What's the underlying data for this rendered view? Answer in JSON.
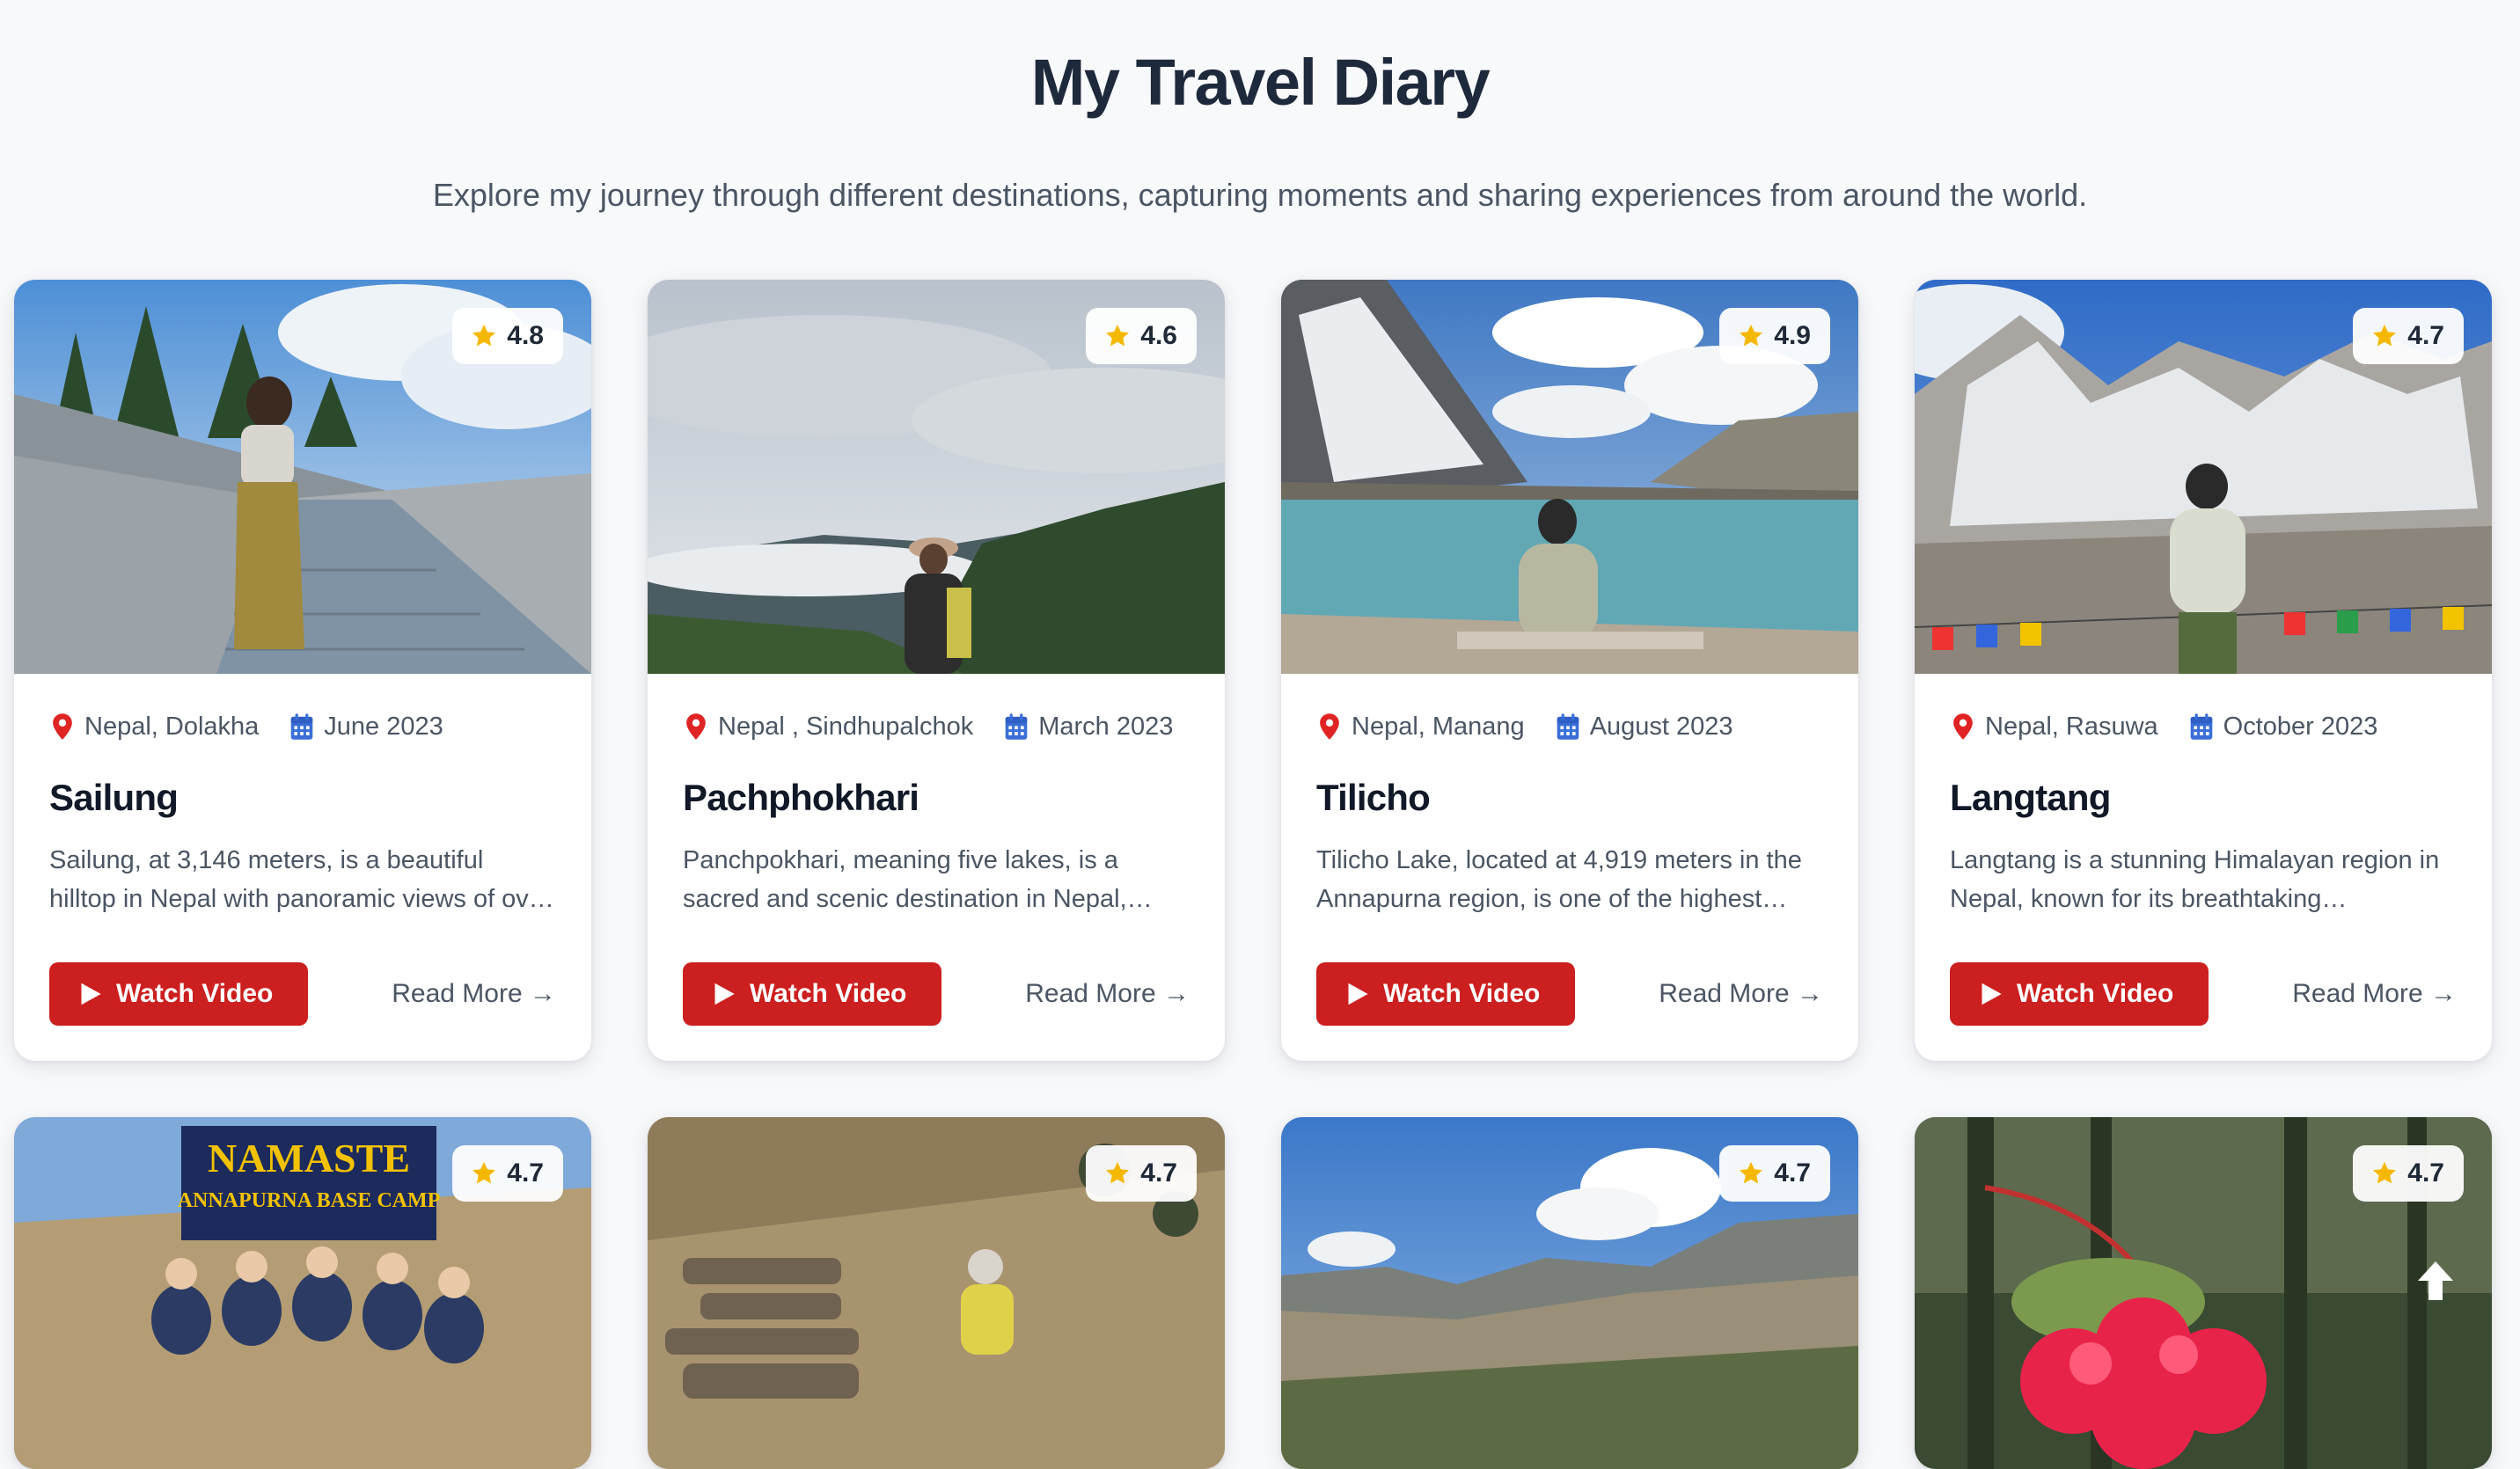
{
  "header": {
    "title": "My Travel Diary",
    "subtitle": "Explore my journey through different destinations, capturing moments and sharing experiences from around the world."
  },
  "accent_color": "#cc1f1f",
  "star_color": "#f5b800",
  "cards": [
    {
      "rating": "4.8",
      "location": "Nepal, Dolakha",
      "date": "June 2023",
      "title": "Sailung",
      "description": "Sailung, at 3,146 meters, is a beautiful hilltop in Nepal with panoramic views of ov…",
      "watch_label": "Watch Video",
      "read_more_label": "Read More →"
    },
    {
      "rating": "4.6",
      "location": "Nepal , Sindhupalchok",
      "date": "March 2023",
      "title": "Pachphokhari",
      "description": "Panchpokhari, meaning five lakes, is a sacred and scenic destination in Nepal,…",
      "watch_label": "Watch Video",
      "read_more_label": "Read More →"
    },
    {
      "rating": "4.9",
      "location": "Nepal, Manang",
      "date": "August 2023",
      "title": "Tilicho",
      "description": "Tilicho Lake, located at 4,919 meters in the Annapurna region, is one of the highest…",
      "watch_label": "Watch Video",
      "read_more_label": "Read More →"
    },
    {
      "rating": "4.7",
      "location": "Nepal, Rasuwa",
      "date": "October 2023",
      "title": "Langtang",
      "description": "Langtang is a stunning Himalayan region in Nepal, known for its breathtaking…",
      "watch_label": "Watch Video",
      "read_more_label": "Read More →"
    },
    {
      "rating": "4.7",
      "sign_line1": "NAMASTE",
      "sign_line2": "ANNAPURNA BASE CAMP"
    },
    {
      "rating": "4.7"
    },
    {
      "rating": "4.7"
    },
    {
      "rating": "4.7"
    }
  ],
  "icons": {
    "location": "map-pin-icon",
    "date": "calendar-icon",
    "rating": "star-icon",
    "watch": "play-icon",
    "scroll": "arrow-up-icon"
  }
}
